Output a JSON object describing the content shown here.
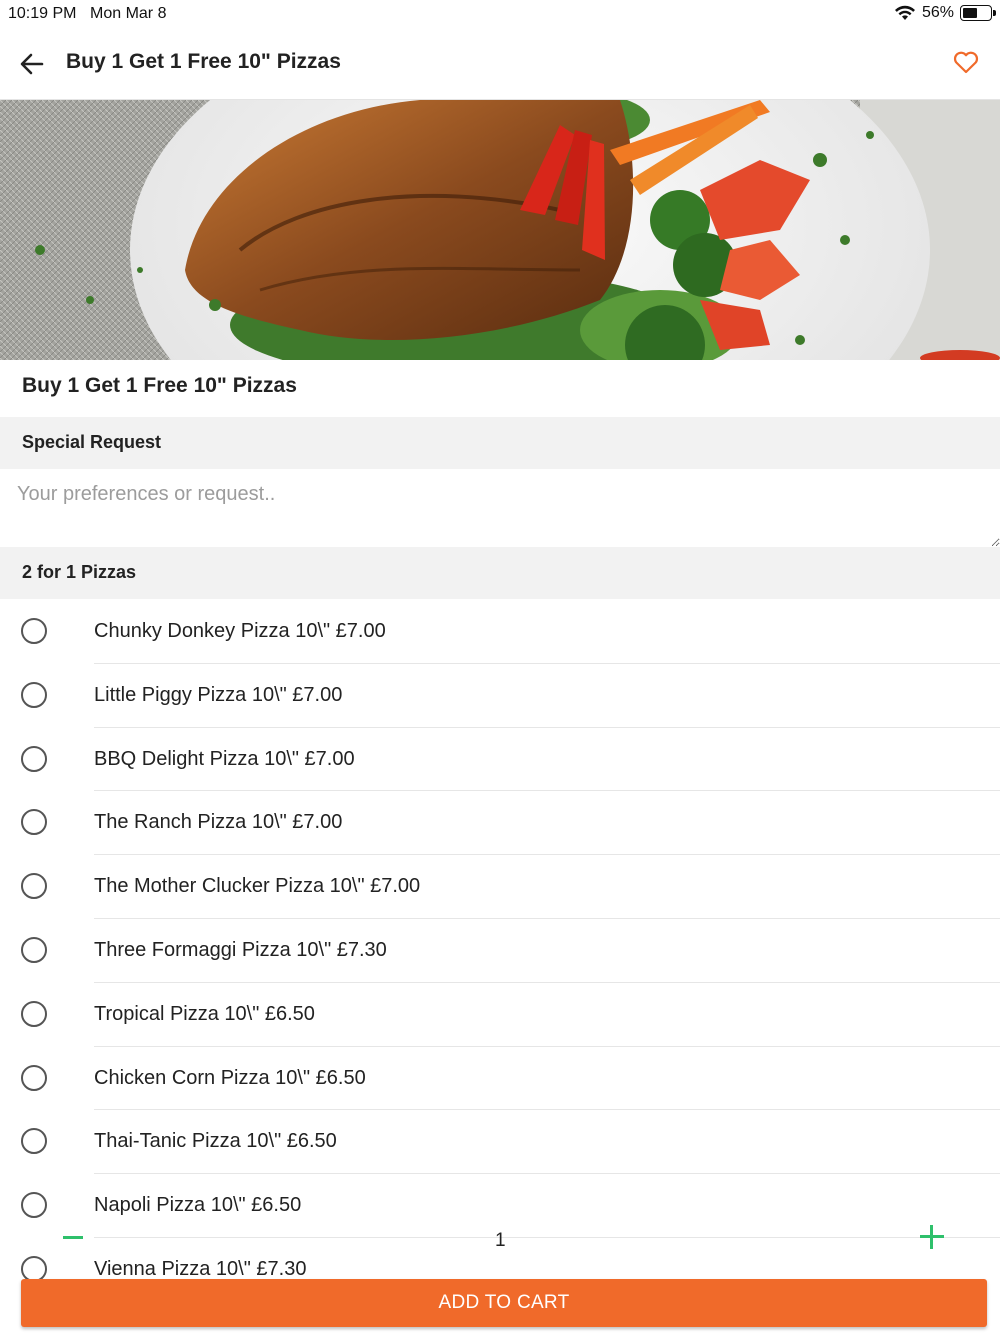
{
  "status_bar": {
    "time": "10:19 PM",
    "date": "Mon Mar 8",
    "battery_text": "56%",
    "battery_level": 0.56
  },
  "header": {
    "title": "Buy 1 Get 1 Free 10\" Pizzas",
    "back_icon": "arrow-left-icon",
    "favorite_icon": "heart-outline-icon"
  },
  "item": {
    "title": "Buy 1 Get 1 Free 10\" Pizzas"
  },
  "special_request": {
    "heading": "Special Request",
    "placeholder": "Your preferences or request..",
    "value": ""
  },
  "options_group": {
    "heading": "2 for 1 Pizzas",
    "items": [
      {
        "label": "Chunky Donkey Pizza 10\\\"  £7.00"
      },
      {
        "label": "Little Piggy Pizza 10\\\"  £7.00"
      },
      {
        "label": "BBQ Delight Pizza 10\\\"  £7.00"
      },
      {
        "label": "The Ranch Pizza 10\\\"  £7.00"
      },
      {
        "label": "The Mother Clucker Pizza 10\\\"  £7.00"
      },
      {
        "label": "Three Formaggi Pizza 10\\\"  £7.30"
      },
      {
        "label": "Tropical Pizza 10\\\"  £6.50"
      },
      {
        "label": "Chicken Corn Pizza 10\\\"  £6.50"
      },
      {
        "label": "Thai-Tanic Pizza 10\\\"  £6.50"
      },
      {
        "label": "Napoli Pizza 10\\\"  £6.50"
      },
      {
        "label": "Vienna Pizza 10\\\"  £7.30"
      }
    ]
  },
  "quantity": {
    "value": "1"
  },
  "cart": {
    "button_label": "ADD TO CART"
  },
  "colors": {
    "accent": "#f06a2a",
    "stepper": "#2ec06b",
    "heart": "#f06a2a"
  }
}
